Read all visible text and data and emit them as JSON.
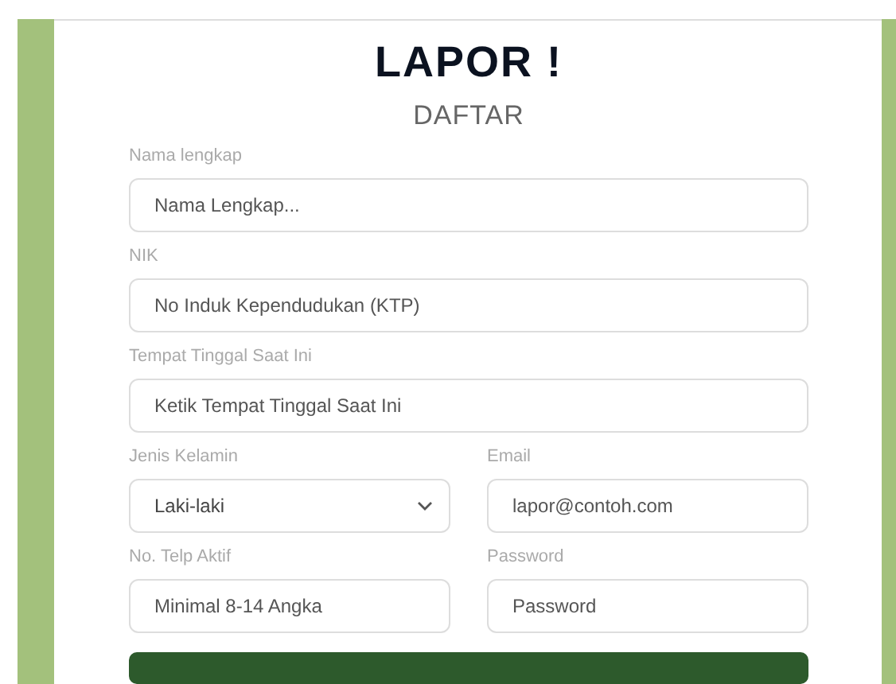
{
  "header": {
    "title": "LAPOR !",
    "subtitle": "DAFTAR"
  },
  "rows": [
    [
      {
        "label": "Nama lengkap",
        "kind": "text",
        "placeholder": "Nama Lengkap..."
      }
    ],
    [
      {
        "label": "NIK",
        "kind": "text",
        "placeholder": "No Induk Kependudukan (KTP)"
      }
    ],
    [
      {
        "label": "Tempat Tinggal Saat Ini",
        "kind": "text",
        "placeholder": "Ketik Tempat Tinggal Saat Ini"
      }
    ],
    [
      {
        "label": "Jenis Kelamin",
        "kind": "select",
        "value": "Laki-laki"
      },
      {
        "label": "Email",
        "kind": "text",
        "placeholder": "lapor@contoh.com"
      }
    ],
    [
      {
        "label": "No. Telp Aktif",
        "kind": "text",
        "placeholder": "Minimal 8-14 Angka"
      },
      {
        "label": "Password",
        "kind": "text",
        "placeholder": "Password"
      }
    ]
  ]
}
